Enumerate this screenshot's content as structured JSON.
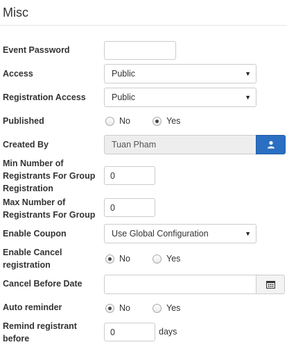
{
  "section": {
    "title": "Misc"
  },
  "fields": {
    "event_password": {
      "label": "Event Password",
      "value": ""
    },
    "access": {
      "label": "Access",
      "value": "Public"
    },
    "registration_access": {
      "label": "Registration Access",
      "value": "Public"
    },
    "published": {
      "label": "Published",
      "options": [
        "No",
        "Yes"
      ],
      "selected": "Yes"
    },
    "created_by": {
      "label": "Created By",
      "value": "Tuan Pham"
    },
    "min_registrants": {
      "label_lines": [
        "Min Number of",
        "Registrants For Group",
        "Registration"
      ],
      "value": "0"
    },
    "max_registrants": {
      "label_lines": [
        "Max Number of",
        "Registrants For Group"
      ],
      "value": "0"
    },
    "enable_coupon": {
      "label": "Enable Coupon",
      "value": "Use Global Configuration"
    },
    "enable_cancel": {
      "label_lines": [
        "Enable Cancel",
        "registration"
      ],
      "options": [
        "No",
        "Yes"
      ],
      "selected": "No"
    },
    "cancel_before_date": {
      "label": "Cancel Before Date",
      "value": ""
    },
    "auto_reminder": {
      "label": "Auto reminder",
      "options": [
        "No",
        "Yes"
      ],
      "selected": "No"
    },
    "remind_before": {
      "label_lines": [
        "Remind registrant",
        "before"
      ],
      "value": "0",
      "suffix": "days"
    }
  },
  "icons": {
    "user_button": "user-icon",
    "calendar_button": "calendar-icon",
    "select_caret": "caret-down-icon"
  },
  "colors": {
    "primary_button": "#2a6fc1"
  }
}
